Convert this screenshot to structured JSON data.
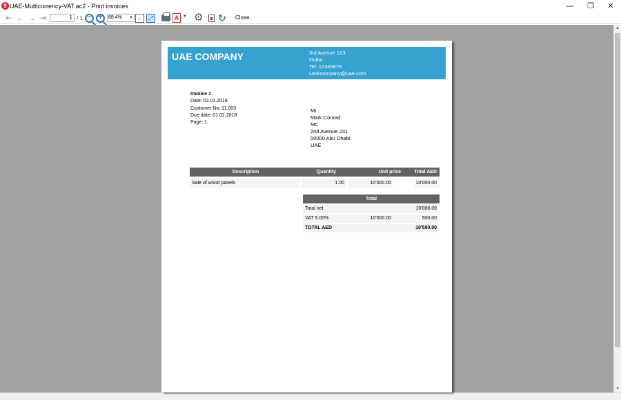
{
  "window": {
    "app_icon": "9",
    "title": "UAE-Multicurrency-VAT.ac2 - Print invoices",
    "minimize": "—",
    "restore": "❐",
    "close": "✕"
  },
  "toolbar": {
    "nav_icons": [
      "first-page-icon",
      "previous-page-icon",
      "next-page-icon",
      "last-page-icon"
    ],
    "page_current": "1",
    "page_total": "/ 1",
    "zoom_value": "88.4%",
    "close_label": "Close"
  },
  "company": {
    "name": "UAE COMPANY",
    "address_lines": [
      "3rd Avenue 123",
      "Dubai",
      "Tel: 12345678",
      "UAEcompany@uae.com"
    ],
    "brand_color": "#35a2cf"
  },
  "invoice": {
    "title": "Invoice 1",
    "date": "Date: 02.01.2018",
    "customer_no": "Customer No: 11.003",
    "due_date": "Due date: 01.02.2018",
    "page": "Page: 1"
  },
  "recipient": {
    "lines": [
      "Mr.",
      "Mark Conrad",
      "MC",
      "2nd Avenue 231",
      "00000 Abu Dhabi",
      "UAE"
    ]
  },
  "items_table": {
    "headers": {
      "description": "Description",
      "quantity": "Quantity",
      "unit_price": "Unit price",
      "total": "Total AED"
    },
    "rows": [
      {
        "description": "Sale of wood panels",
        "quantity": "1.00",
        "unit_price": "10'000.00",
        "total": "10'000.00"
      }
    ]
  },
  "totals_table": {
    "header": "Total",
    "total_net_label": "Total net",
    "total_net_value": "10'000.00",
    "vat_label": "VAT 5.00%",
    "vat_base": "10'000.00",
    "vat_value": "500.00",
    "grand_label": "TOTAL AED",
    "grand_value": "10'500.00"
  }
}
